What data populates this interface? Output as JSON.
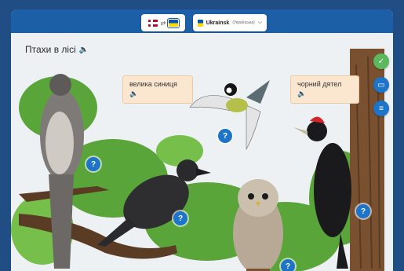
{
  "header": {
    "source_flag": "norway-flag-icon",
    "target_flag": "ukraine-flag-icon",
    "language_select": {
      "label": "Ukrainsk",
      "native": "(Українська)"
    }
  },
  "scene": {
    "title": "Птахи в лісі",
    "labels": [
      {
        "id": "great-tit",
        "text": "велика синиця"
      },
      {
        "id": "black-woodpecker",
        "text": "чорний дятел"
      }
    ],
    "info_hotspot_glyph": "?",
    "side_buttons": [
      {
        "id": "confirm",
        "icon": "check-icon",
        "color": "#5cb85c"
      },
      {
        "id": "chat",
        "icon": "speech-bubble-icon",
        "color": "#1d74c8"
      },
      {
        "id": "menu",
        "icon": "list-icon",
        "color": "#1d74c8"
      }
    ]
  },
  "colors": {
    "background": "#1f4d84",
    "header_bar": "#1c5fa6",
    "label_fill": "#fbe6cf",
    "hotspot": "#1d74c8"
  }
}
